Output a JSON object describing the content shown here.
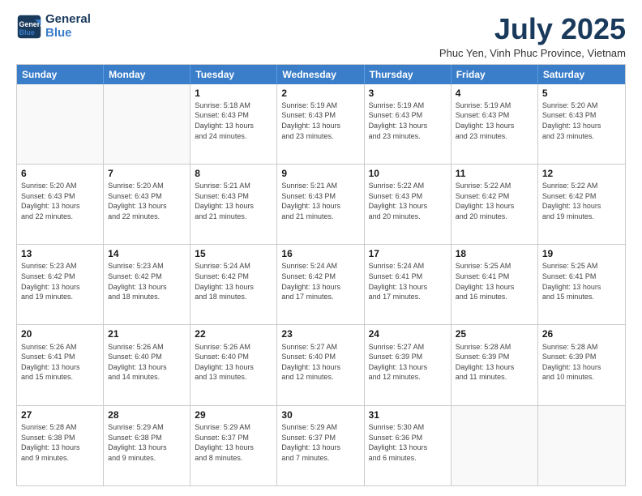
{
  "logo": {
    "line1": "General",
    "line2": "Blue"
  },
  "title": "July 2025",
  "location": "Phuc Yen, Vinh Phuc Province, Vietnam",
  "header_days": [
    "Sunday",
    "Monday",
    "Tuesday",
    "Wednesday",
    "Thursday",
    "Friday",
    "Saturday"
  ],
  "weeks": [
    [
      {
        "day": "",
        "info": ""
      },
      {
        "day": "",
        "info": ""
      },
      {
        "day": "1",
        "info": "Sunrise: 5:18 AM\nSunset: 6:43 PM\nDaylight: 13 hours\nand 24 minutes."
      },
      {
        "day": "2",
        "info": "Sunrise: 5:19 AM\nSunset: 6:43 PM\nDaylight: 13 hours\nand 23 minutes."
      },
      {
        "day": "3",
        "info": "Sunrise: 5:19 AM\nSunset: 6:43 PM\nDaylight: 13 hours\nand 23 minutes."
      },
      {
        "day": "4",
        "info": "Sunrise: 5:19 AM\nSunset: 6:43 PM\nDaylight: 13 hours\nand 23 minutes."
      },
      {
        "day": "5",
        "info": "Sunrise: 5:20 AM\nSunset: 6:43 PM\nDaylight: 13 hours\nand 23 minutes."
      }
    ],
    [
      {
        "day": "6",
        "info": "Sunrise: 5:20 AM\nSunset: 6:43 PM\nDaylight: 13 hours\nand 22 minutes."
      },
      {
        "day": "7",
        "info": "Sunrise: 5:20 AM\nSunset: 6:43 PM\nDaylight: 13 hours\nand 22 minutes."
      },
      {
        "day": "8",
        "info": "Sunrise: 5:21 AM\nSunset: 6:43 PM\nDaylight: 13 hours\nand 21 minutes."
      },
      {
        "day": "9",
        "info": "Sunrise: 5:21 AM\nSunset: 6:43 PM\nDaylight: 13 hours\nand 21 minutes."
      },
      {
        "day": "10",
        "info": "Sunrise: 5:22 AM\nSunset: 6:43 PM\nDaylight: 13 hours\nand 20 minutes."
      },
      {
        "day": "11",
        "info": "Sunrise: 5:22 AM\nSunset: 6:42 PM\nDaylight: 13 hours\nand 20 minutes."
      },
      {
        "day": "12",
        "info": "Sunrise: 5:22 AM\nSunset: 6:42 PM\nDaylight: 13 hours\nand 19 minutes."
      }
    ],
    [
      {
        "day": "13",
        "info": "Sunrise: 5:23 AM\nSunset: 6:42 PM\nDaylight: 13 hours\nand 19 minutes."
      },
      {
        "day": "14",
        "info": "Sunrise: 5:23 AM\nSunset: 6:42 PM\nDaylight: 13 hours\nand 18 minutes."
      },
      {
        "day": "15",
        "info": "Sunrise: 5:24 AM\nSunset: 6:42 PM\nDaylight: 13 hours\nand 18 minutes."
      },
      {
        "day": "16",
        "info": "Sunrise: 5:24 AM\nSunset: 6:42 PM\nDaylight: 13 hours\nand 17 minutes."
      },
      {
        "day": "17",
        "info": "Sunrise: 5:24 AM\nSunset: 6:41 PM\nDaylight: 13 hours\nand 17 minutes."
      },
      {
        "day": "18",
        "info": "Sunrise: 5:25 AM\nSunset: 6:41 PM\nDaylight: 13 hours\nand 16 minutes."
      },
      {
        "day": "19",
        "info": "Sunrise: 5:25 AM\nSunset: 6:41 PM\nDaylight: 13 hours\nand 15 minutes."
      }
    ],
    [
      {
        "day": "20",
        "info": "Sunrise: 5:26 AM\nSunset: 6:41 PM\nDaylight: 13 hours\nand 15 minutes."
      },
      {
        "day": "21",
        "info": "Sunrise: 5:26 AM\nSunset: 6:40 PM\nDaylight: 13 hours\nand 14 minutes."
      },
      {
        "day": "22",
        "info": "Sunrise: 5:26 AM\nSunset: 6:40 PM\nDaylight: 13 hours\nand 13 minutes."
      },
      {
        "day": "23",
        "info": "Sunrise: 5:27 AM\nSunset: 6:40 PM\nDaylight: 13 hours\nand 12 minutes."
      },
      {
        "day": "24",
        "info": "Sunrise: 5:27 AM\nSunset: 6:39 PM\nDaylight: 13 hours\nand 12 minutes."
      },
      {
        "day": "25",
        "info": "Sunrise: 5:28 AM\nSunset: 6:39 PM\nDaylight: 13 hours\nand 11 minutes."
      },
      {
        "day": "26",
        "info": "Sunrise: 5:28 AM\nSunset: 6:39 PM\nDaylight: 13 hours\nand 10 minutes."
      }
    ],
    [
      {
        "day": "27",
        "info": "Sunrise: 5:28 AM\nSunset: 6:38 PM\nDaylight: 13 hours\nand 9 minutes."
      },
      {
        "day": "28",
        "info": "Sunrise: 5:29 AM\nSunset: 6:38 PM\nDaylight: 13 hours\nand 9 minutes."
      },
      {
        "day": "29",
        "info": "Sunrise: 5:29 AM\nSunset: 6:37 PM\nDaylight: 13 hours\nand 8 minutes."
      },
      {
        "day": "30",
        "info": "Sunrise: 5:29 AM\nSunset: 6:37 PM\nDaylight: 13 hours\nand 7 minutes."
      },
      {
        "day": "31",
        "info": "Sunrise: 5:30 AM\nSunset: 6:36 PM\nDaylight: 13 hours\nand 6 minutes."
      },
      {
        "day": "",
        "info": ""
      },
      {
        "day": "",
        "info": ""
      }
    ]
  ]
}
